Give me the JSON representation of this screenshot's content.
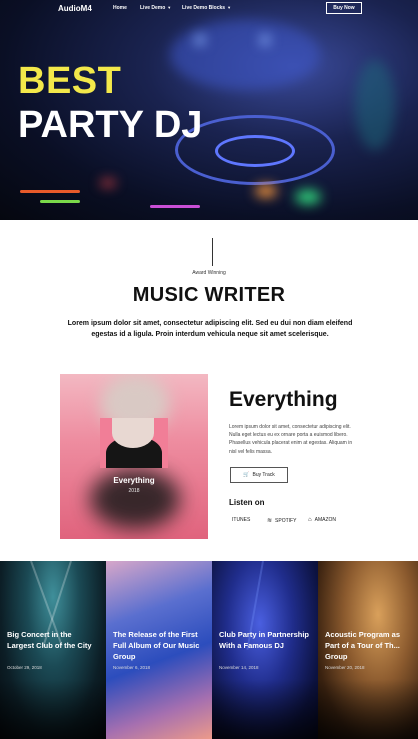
{
  "nav": {
    "logo": "AudioM4",
    "links": [
      "Home",
      "Live Demo",
      "Live Demo Blocks"
    ],
    "buy_label": "Buy Now"
  },
  "hero": {
    "line1": "BEST",
    "line2": "PARTY DJ"
  },
  "writer": {
    "subtitle": "Award Winning",
    "title": "MUSIC WRITER",
    "text": "Lorem ipsum dolor sit amet, consectetur adipiscing elit. Sed eu dui non diam eleifend egestas id a ligula. Proin interdum vehicula neque sit amet scelerisque."
  },
  "album": {
    "cover_title": "Everything",
    "cover_year": "2018",
    "title": "Everything",
    "description": "Lorem ipsum dolor sit amet, consectetur adipiscing elit. Nulla eget lectus eu ex ornare porta a euismod libero. Phasellus vehicula placerat enim at egestas. Aliquam in nisl vel felis massa.",
    "buy_label": "Buy Track",
    "listen_label": "Listen on",
    "services": [
      {
        "name": "ITUNES",
        "icon": "apple-icon"
      },
      {
        "name": "SPOTIFY",
        "icon": "spotify-icon"
      },
      {
        "name": "AMAZON",
        "icon": "amazon-icon"
      }
    ]
  },
  "posts": [
    {
      "title": "Big Concert in the Largest Club of the City",
      "date": "October 29, 2018"
    },
    {
      "title": "The Release of the First Full Album of Our Music Group",
      "date": "November 6, 2018"
    },
    {
      "title": "Club Party in Partnership With a Famous DJ",
      "date": "November 14, 2018"
    },
    {
      "title": "Acoustic Program as Part of a Tour of Th... Group",
      "date": "November 20, 2018"
    }
  ],
  "colors": {
    "hero_accent": "#f3e84a",
    "cover_pink": "#ee8da0"
  }
}
